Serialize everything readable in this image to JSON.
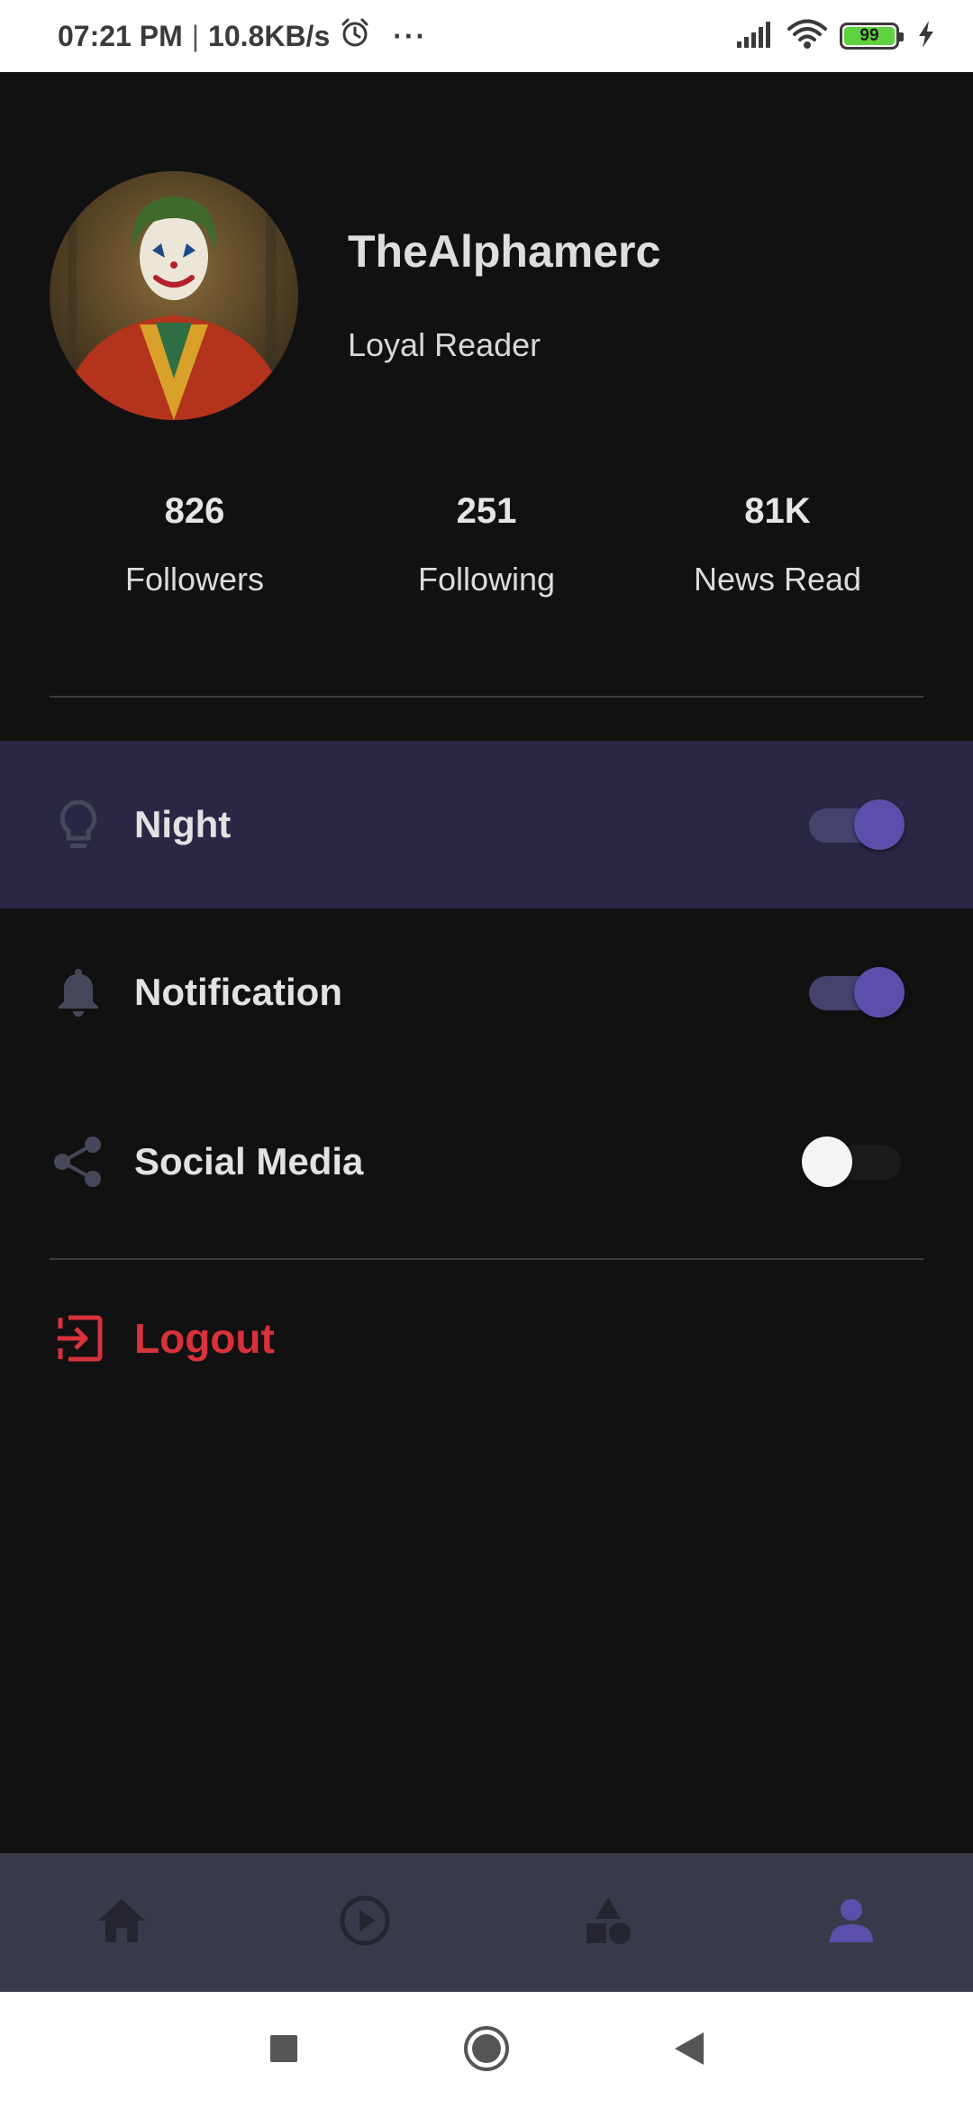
{
  "status_bar": {
    "time": "07:21 PM",
    "separator": "|",
    "network_speed": "10.8KB/s",
    "more": "···",
    "battery_level": "99",
    "icons": [
      "alarm-icon",
      "signal-icon",
      "wifi-icon",
      "battery-icon",
      "charging-icon"
    ]
  },
  "profile": {
    "username": "TheAlphamerc",
    "role": "Loyal Reader",
    "avatar": "joker-avatar"
  },
  "stats": [
    {
      "value": "826",
      "label": "Followers"
    },
    {
      "value": "251",
      "label": "Following"
    },
    {
      "value": "81K",
      "label": "News Read"
    }
  ],
  "settings": [
    {
      "label": "Night",
      "icon": "lightbulb-icon",
      "enabled": true,
      "highlighted": true
    },
    {
      "label": "Notification",
      "icon": "bell-icon",
      "enabled": true,
      "highlighted": false
    },
    {
      "label": "Social Media",
      "icon": "share-icon",
      "enabled": false,
      "highlighted": false
    }
  ],
  "logout": {
    "label": "Logout",
    "icon": "logout-icon"
  },
  "bottom_nav": {
    "items": [
      "home-icon",
      "play-icon",
      "category-icon",
      "profile-icon"
    ],
    "active": "profile-icon"
  },
  "system_nav": [
    "recent-apps-icon",
    "home-button-icon",
    "back-icon"
  ],
  "colors": {
    "background": "#111112",
    "highlight_row": "#2a2745",
    "accent": "#5b4fab",
    "logout": "#d8323a",
    "bottom_nav": "#393a49"
  }
}
